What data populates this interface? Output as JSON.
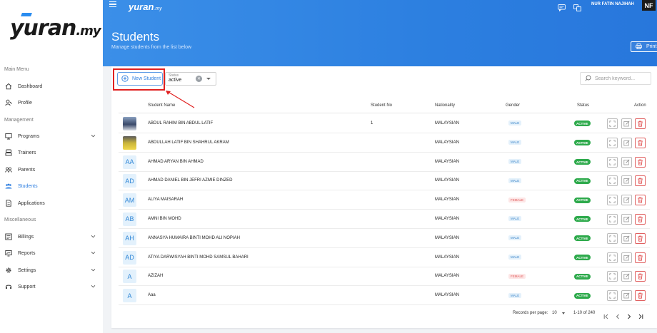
{
  "app": {
    "logo": "yuran",
    "logo_suffix": ".my",
    "user_name": "NUR FATIN NAJIHAH",
    "user_initials": "NF"
  },
  "sidebar": {
    "sections": {
      "main": "Main Menu",
      "management": "Management",
      "misc": "Miscellaneous"
    },
    "items": [
      {
        "label": "Dashboard",
        "icon": "home-icon"
      },
      {
        "label": "Profile",
        "icon": "user-profile-icon"
      },
      {
        "label": "Programs",
        "icon": "monitor-icon"
      },
      {
        "label": "Trainers",
        "icon": "trainer-icon"
      },
      {
        "label": "Parents",
        "icon": "people-icon"
      },
      {
        "label": "Students",
        "icon": "students-icon"
      },
      {
        "label": "Applications",
        "icon": "document-icon"
      },
      {
        "label": "Billings",
        "icon": "billing-icon"
      },
      {
        "label": "Reports",
        "icon": "reports-icon"
      },
      {
        "label": "Settings",
        "icon": "gear-icon"
      },
      {
        "label": "Support",
        "icon": "headset-icon"
      }
    ]
  },
  "header": {
    "title": "Students",
    "subtitle": "Manage students from the list below",
    "print_label": "Print"
  },
  "toolbar": {
    "new_student_label": "New Student",
    "status_label": "Status",
    "status_value": "active",
    "search_placeholder": "Search keyword..."
  },
  "table": {
    "columns": [
      "Student Name",
      "Student No",
      "Nationality",
      "Gender",
      "Status",
      "Action"
    ],
    "rows": [
      {
        "avatar": "",
        "name": "ABDUL RAHIM BIN ABDUL LATIF",
        "no": "1",
        "nationality": "MALAYSIAN",
        "gender": "MALE",
        "status": "ACTIVE"
      },
      {
        "avatar": "",
        "name": "ABDULLAH LATIF BIN SHAHRUL AKRAM",
        "no": "",
        "nationality": "MALAYSIAN",
        "gender": "MALE",
        "status": "ACTIVE"
      },
      {
        "avatar": "AA",
        "name": "AHMAD ARYAN BIN AHMAD",
        "no": "",
        "nationality": "MALAYSIAN",
        "gender": "MALE",
        "status": "ACTIVE"
      },
      {
        "avatar": "AD",
        "name": "AHMAD DANIEL BIN JEFRI AZMIE DINZED",
        "no": "",
        "nationality": "MALAYSIAN",
        "gender": "MALE",
        "status": "ACTIVE"
      },
      {
        "avatar": "AM",
        "name": "ALIYA MAISARAH",
        "no": "",
        "nationality": "MALAYSIAN",
        "gender": "FEMALE",
        "status": "ACTIVE"
      },
      {
        "avatar": "AB",
        "name": "AMNI BIN MOHD",
        "no": "",
        "nationality": "MALAYSIAN",
        "gender": "MALE",
        "status": "ACTIVE"
      },
      {
        "avatar": "AH",
        "name": "ANNASYA HUMAIRA BINTI MOHD ALI NOPIAH",
        "no": "",
        "nationality": "MALAYSIAN",
        "gender": "MALE",
        "status": "ACTIVE"
      },
      {
        "avatar": "AD",
        "name": "ATIYA DARWISYAH BINTI MOHD SAMSUL BAHARI",
        "no": "",
        "nationality": "MALAYSIAN",
        "gender": "MALE",
        "status": "ACTIVE"
      },
      {
        "avatar": "A",
        "name": "AZIZAH",
        "no": "",
        "nationality": "MALAYSIAN",
        "gender": "FEMALE",
        "status": "ACTIVE"
      },
      {
        "avatar": "A",
        "name": "Aaa",
        "no": "",
        "nationality": "MALAYSIAN",
        "gender": "MALE",
        "status": "ACTIVE"
      }
    ]
  },
  "pagination": {
    "records_label": "Records per page:",
    "per_page": "10",
    "range": "1-10 of 240"
  },
  "colors": {
    "accent": "#2f7fe0",
    "banner": "#2c7fe0",
    "active_green": "#2eaa4c",
    "highlight_red": "#e02020"
  }
}
